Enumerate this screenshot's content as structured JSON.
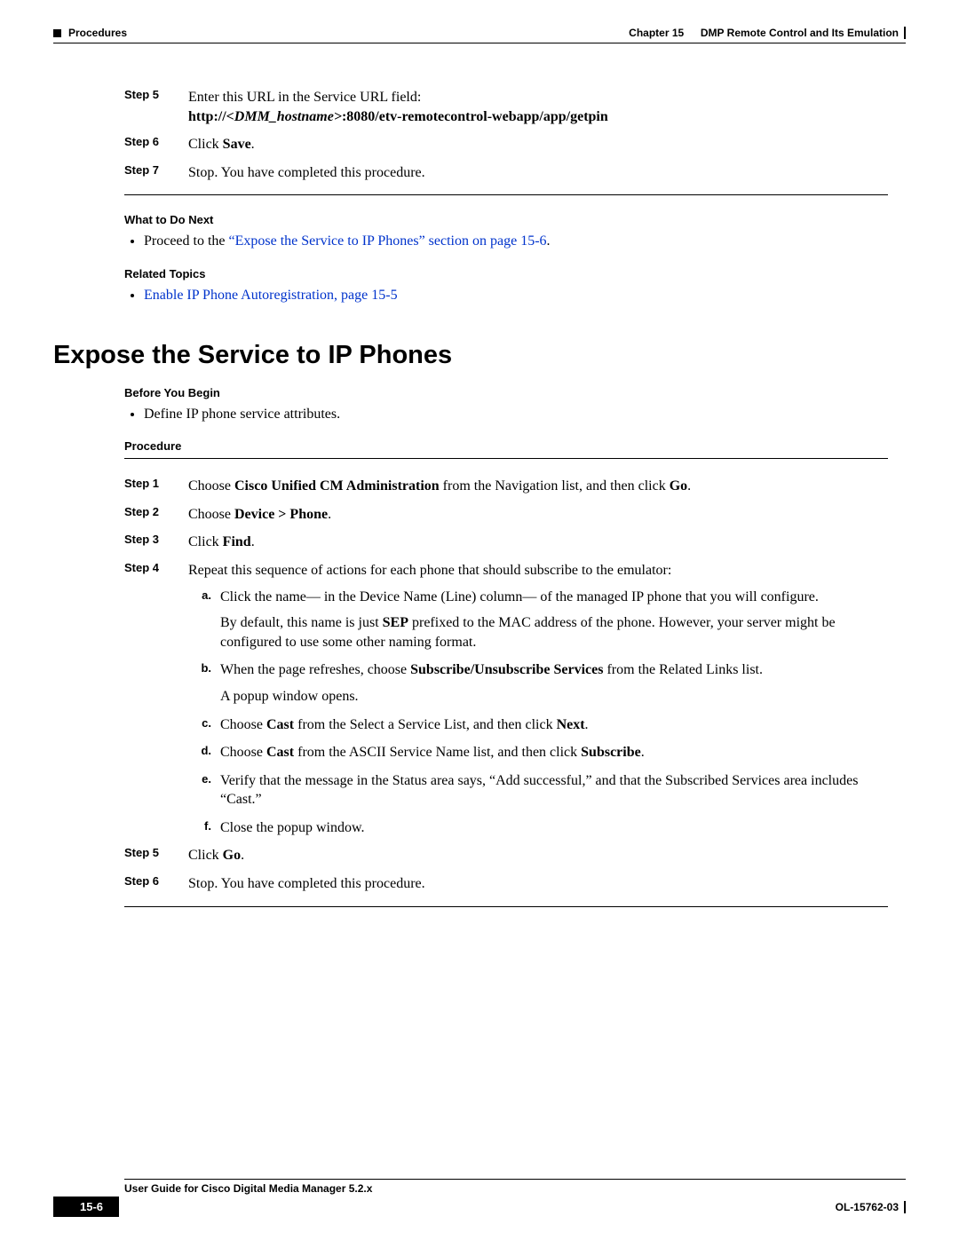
{
  "header": {
    "left_label": "Procedures",
    "chapter": "Chapter 15",
    "chapter_title": "DMP Remote Control and Its Emulation"
  },
  "top_steps": {
    "step5_label": "Step 5",
    "step5_line1": "Enter this URL in the Service URL field:",
    "step5_url_prefix": "http://",
    "step5_url_var": "<DMM_hostname>",
    "step5_url_suffix": ":8080/etv-remotecontrol-webapp/app/getpin",
    "step6_label": "Step 6",
    "step6_prefix": "Click ",
    "step6_bold": "Save",
    "step6_suffix": ".",
    "step7_label": "Step 7",
    "step7_text": "Stop. You have completed this procedure."
  },
  "what_next": {
    "heading": "What to Do Next",
    "bullet_prefix": "Proceed to the ",
    "bullet_link": "“Expose the Service to IP Phones” section on page 15-6",
    "bullet_suffix": "."
  },
  "related": {
    "heading": "Related Topics",
    "bullet_link": "Enable IP Phone Autoregistration, page 15-5"
  },
  "section_title": "Expose the Service to IP Phones",
  "before": {
    "heading": "Before You Begin",
    "bullet": "Define IP phone service attributes."
  },
  "procedure_heading": "Procedure",
  "proc_steps": {
    "s1_label": "Step 1",
    "s1_p1": "Choose ",
    "s1_b1": "Cisco Unified CM Administration",
    "s1_p2": " from the Navigation list, and then click ",
    "s1_b2": "Go",
    "s1_p3": ".",
    "s2_label": "Step 2",
    "s2_p1": "Choose ",
    "s2_b1": "Device > Phone",
    "s2_p2": ".",
    "s3_label": "Step 3",
    "s3_p1": "Click ",
    "s3_b1": "Find",
    "s3_p2": ".",
    "s4_label": "Step 4",
    "s4_text": "Repeat this sequence of actions for each phone that should subscribe to the emulator:",
    "a_label": "a.",
    "a_text": "Click the name— in the Device Name (Line) column— of the managed IP phone that you will configure.",
    "a_extra_p1": "By default, this name is just ",
    "a_extra_b1": "SEP",
    "a_extra_p2": " prefixed to the MAC address of the phone. However, your server might be configured to use some other naming format.",
    "b_label": "b.",
    "b_p1": "When the page refreshes, choose ",
    "b_b1": "Subscribe/Unsubscribe Services",
    "b_p2": " from the Related Links list.",
    "b_extra": "A popup window opens.",
    "c_label": "c.",
    "c_p1": "Choose ",
    "c_b1": "Cast",
    "c_p2": " from the Select a Service List, and then click ",
    "c_b2": "Next",
    "c_p3": ".",
    "d_label": "d.",
    "d_p1": "Choose ",
    "d_b1": "Cast",
    "d_p2": " from the ASCII Service Name list, and then click ",
    "d_b2": "Subscribe",
    "d_p3": ".",
    "e_label": "e.",
    "e_text": "Verify that the message in the Status area says, “Add successful,” and that the Subscribed Services area includes “Cast.”",
    "f_label": "f.",
    "f_text": "Close the popup window.",
    "s5_label": "Step 5",
    "s5_p1": "Click ",
    "s5_b1": "Go",
    "s5_p2": ".",
    "s6_label": "Step 6",
    "s6_text": "Stop. You have completed this procedure."
  },
  "footer": {
    "title": "User Guide for Cisco Digital Media Manager 5.2.x",
    "page_number": "15-6",
    "doc_id": "OL-15762-03"
  }
}
